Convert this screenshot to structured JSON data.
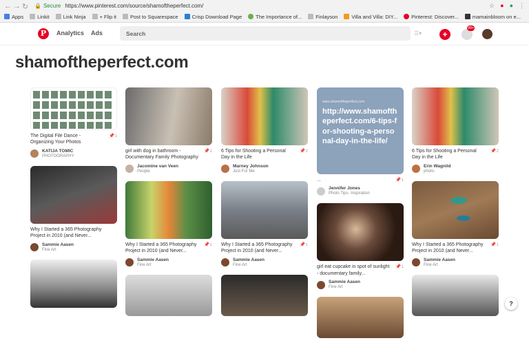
{
  "browser": {
    "secure_label": "Secure",
    "url": "https://www.pinterest.com/source/shamoftheperfect.com/",
    "bookmarks": [
      "Apps",
      "Linkit",
      "Link Ninja",
      "+ Flip it",
      "Post to Squarespace",
      "Crisp Download Page",
      "The Importance of...",
      "Finlayson",
      "Villa and Villa: DIY...",
      "Pinterest: Discover...",
      "mamainbloom on e..."
    ]
  },
  "header": {
    "logo": "P",
    "nav": [
      "Analytics",
      "Ads"
    ],
    "search_placeholder": "Search",
    "notification_count": "99+"
  },
  "page": {
    "title": "shamoftheperfect.com"
  },
  "columns": [
    [
      {
        "desc": "The Digital File Dance - Organizing Your Photos",
        "pins": "1",
        "author": "KATIJA TOMIC",
        "board": "PHOTOGRAPHY"
      },
      {
        "desc": "Why I Started a 365 Photography Project in 2010 (and Never...",
        "pins": "",
        "author": "Sammie Aasen",
        "board": "Fine Art"
      },
      {
        "desc": "",
        "pins": "",
        "author": "",
        "board": ""
      }
    ],
    [
      {
        "desc": "girl with dog in bathroom - Documentary Family Photography",
        "pins": "1",
        "author": "Jacomine van Veen",
        "board": "People"
      },
      {
        "desc": "Why I Started a 365 Photography Project in 2010 (and Never...",
        "pins": "1",
        "author": "Sammie Aasen",
        "board": "Fine Art"
      },
      {
        "desc": "",
        "pins": "",
        "author": "",
        "board": ""
      }
    ],
    [
      {
        "desc": "6 Tips for Shooting a Personal Day in the Life",
        "pins": "2",
        "author": "Marney Johnson",
        "board": "Just For Me"
      },
      {
        "desc": "Why I Started a 365 Photography Project in 2010 (and Never...",
        "pins": "1",
        "author": "Sammie Aasen",
        "board": "Fine Art"
      },
      {
        "desc": "",
        "pins": "",
        "author": "",
        "board": ""
      }
    ],
    [
      {
        "link_small": "www.shamoftheperfect.com",
        "link_big": "http://www.shamoftheperfect.com/6-tips-for-shooting-a-personal-day-in-the-life/",
        "desc": "...",
        "pins": "1",
        "author": "Jennifer Jones",
        "board": "Photo Tips- Inspiration"
      },
      {
        "desc": "girl eat cupcake in spot of sunlight - documentary family...",
        "pins": "1",
        "author": "Sammie Aasen",
        "board": "Fine Art"
      },
      {
        "desc": "",
        "pins": "",
        "author": "",
        "board": ""
      }
    ],
    [
      {
        "desc": "6 Tips for Shooting a Personal Day in the Life",
        "pins": "2",
        "author": "Erin Wagnild",
        "board": "photo."
      },
      {
        "desc": "Why I Started a 365 Photography Project in 2010 (and Never...",
        "pins": "1",
        "author": "Sammie Aasen",
        "board": "Fine Art"
      },
      {
        "desc": "",
        "pins": "",
        "author": "",
        "board": ""
      }
    ]
  ],
  "help_label": "?"
}
